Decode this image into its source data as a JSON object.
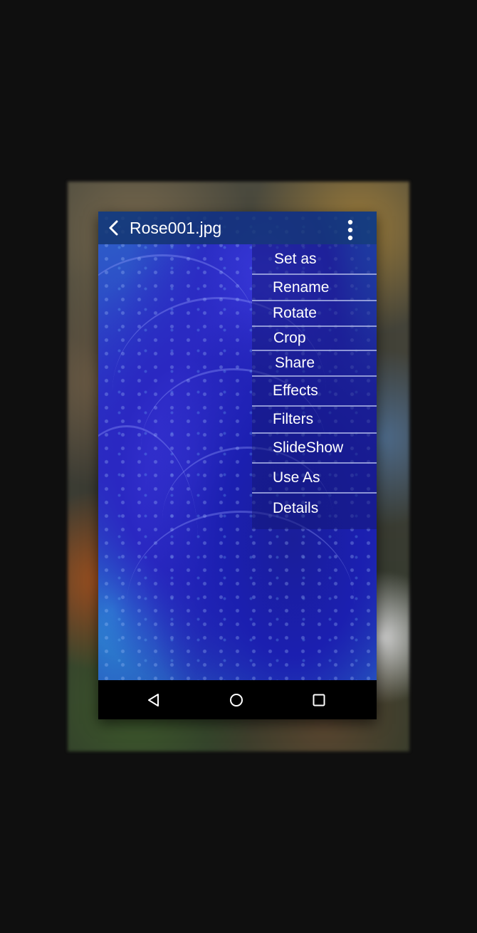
{
  "appbar": {
    "title": "Rose001.jpg"
  },
  "icons": {
    "back": "chevron-left-icon",
    "overflow": "more-vertical-icon",
    "nav_back": "triangle-back-icon",
    "nav_home": "circle-home-icon",
    "nav_recents": "square-recents-icon"
  },
  "menu": {
    "items": [
      {
        "label": "Set as"
      },
      {
        "label": "Rename"
      },
      {
        "label": "Rotate"
      },
      {
        "label": "Crop"
      },
      {
        "label": "Share"
      },
      {
        "label": "Effects"
      },
      {
        "label": "Filters"
      },
      {
        "label": "SlideShow"
      },
      {
        "label": "Use As"
      },
      {
        "label": "Details"
      }
    ]
  },
  "colors": {
    "page_background": "#0f0f0f",
    "appbar": "#12346e",
    "menu_text": "#ffffff",
    "navbar": "#000000"
  }
}
